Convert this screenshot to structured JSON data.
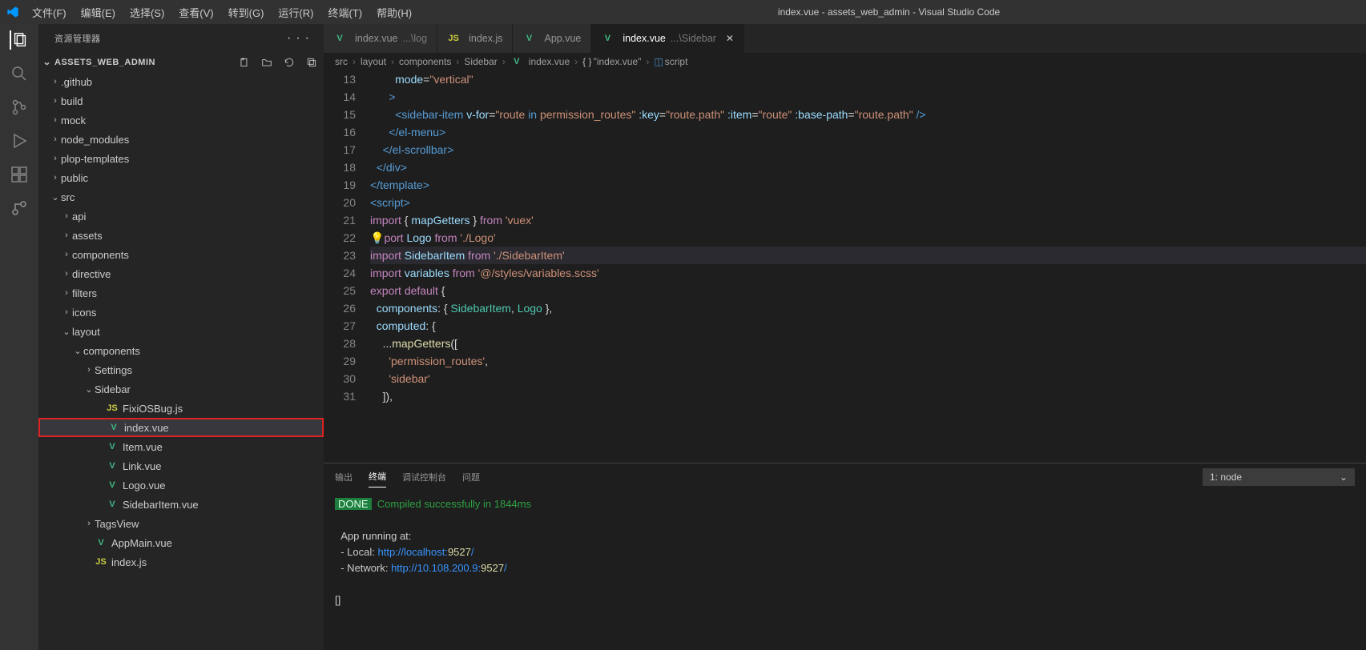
{
  "window_title": "index.vue - assets_web_admin - Visual Studio Code",
  "menu": [
    "文件(F)",
    "编辑(E)",
    "选择(S)",
    "查看(V)",
    "转到(G)",
    "运行(R)",
    "终端(T)",
    "帮助(H)"
  ],
  "sidebar_title": "资源管理器",
  "project_name": "ASSETS_WEB_ADMIN",
  "tree": [
    {
      "depth": 0,
      "tw": "›",
      "label": ".github",
      "icon": ""
    },
    {
      "depth": 0,
      "tw": "›",
      "label": "build",
      "icon": ""
    },
    {
      "depth": 0,
      "tw": "›",
      "label": "mock",
      "icon": ""
    },
    {
      "depth": 0,
      "tw": "›",
      "label": "node_modules",
      "icon": ""
    },
    {
      "depth": 0,
      "tw": "›",
      "label": "plop-templates",
      "icon": ""
    },
    {
      "depth": 0,
      "tw": "›",
      "label": "public",
      "icon": ""
    },
    {
      "depth": 0,
      "tw": "⌄",
      "label": "src",
      "icon": ""
    },
    {
      "depth": 1,
      "tw": "›",
      "label": "api",
      "icon": ""
    },
    {
      "depth": 1,
      "tw": "›",
      "label": "assets",
      "icon": ""
    },
    {
      "depth": 1,
      "tw": "›",
      "label": "components",
      "icon": ""
    },
    {
      "depth": 1,
      "tw": "›",
      "label": "directive",
      "icon": ""
    },
    {
      "depth": 1,
      "tw": "›",
      "label": "filters",
      "icon": ""
    },
    {
      "depth": 1,
      "tw": "›",
      "label": "icons",
      "icon": ""
    },
    {
      "depth": 1,
      "tw": "⌄",
      "label": "layout",
      "icon": ""
    },
    {
      "depth": 2,
      "tw": "⌄",
      "label": "components",
      "icon": ""
    },
    {
      "depth": 3,
      "tw": "›",
      "label": "Settings",
      "icon": ""
    },
    {
      "depth": 3,
      "tw": "⌄",
      "label": "Sidebar",
      "icon": ""
    },
    {
      "depth": 4,
      "tw": "",
      "label": "FixiOSBug.js",
      "icon": "js"
    },
    {
      "depth": 4,
      "tw": "",
      "label": "index.vue",
      "icon": "vue",
      "sel": true,
      "box": true
    },
    {
      "depth": 4,
      "tw": "",
      "label": "Item.vue",
      "icon": "vue"
    },
    {
      "depth": 4,
      "tw": "",
      "label": "Link.vue",
      "icon": "vue"
    },
    {
      "depth": 4,
      "tw": "",
      "label": "Logo.vue",
      "icon": "vue"
    },
    {
      "depth": 4,
      "tw": "",
      "label": "SidebarItem.vue",
      "icon": "vue"
    },
    {
      "depth": 3,
      "tw": "›",
      "label": "TagsView",
      "icon": ""
    },
    {
      "depth": 3,
      "tw": "",
      "label": "AppMain.vue",
      "icon": "vue"
    },
    {
      "depth": 3,
      "tw": "",
      "label": "index.js",
      "icon": "js"
    }
  ],
  "tabs": [
    {
      "icon": "vue",
      "label": "index.vue",
      "detail": "...\\log",
      "active": false
    },
    {
      "icon": "js",
      "label": "index.js",
      "detail": "",
      "active": false
    },
    {
      "icon": "vue",
      "label": "App.vue",
      "detail": "",
      "active": false
    },
    {
      "icon": "vue",
      "label": "index.vue",
      "detail": "...\\Sidebar",
      "active": true,
      "close": true
    }
  ],
  "breadcrumb": [
    "src",
    "layout",
    "components",
    "Sidebar",
    "index.vue",
    "\"index.vue\"",
    "script"
  ],
  "code": {
    "start": 13,
    "lines": [
      "        <span class='tk-attr'>mode</span><span class='tk-op'>=</span><span class='tk-str'>\"vertical\"</span>",
      "      <span class='tk-tag'>&gt;</span>",
      "        <span class='tk-tag'>&lt;sidebar-item</span> <span class='tk-attr'>v-for</span><span class='tk-op'>=</span><span class='tk-str'>\"route <span class='tk-bl'>in</span> permission_routes\"</span> <span class='tk-attr'>:key</span><span class='tk-op'>=</span><span class='tk-str'>\"route.path\"</span> <span class='tk-attr'>:item</span><span class='tk-op'>=</span><span class='tk-str'>\"route\"</span> <span class='tk-attr'>:base-path</span><span class='tk-op'>=</span><span class='tk-str'>\"route.path\"</span> <span class='tk-tag'>/&gt;</span>",
      "      <span class='tk-tag'>&lt;/el-menu&gt;</span>",
      "    <span class='tk-tag'>&lt;/el-scrollbar&gt;</span>",
      "  <span class='tk-tag'>&lt;/div&gt;</span>",
      "<span class='tk-tag'>&lt;/template&gt;</span>",
      "<span class='tk-tag'>&lt;script&gt;</span>",
      "<span class='tk-kw'>import</span> <span class='tk-pn'>{</span> <span class='tk-attr'>mapGetters</span> <span class='tk-pn'>}</span> <span class='tk-kw'>from</span> <span class='tk-str'>'vuex'</span>",
      "<span class='bulb'>💡</span><span class='tk-kw'>port</span> <span class='tk-attr'>Logo</span> <span class='tk-kw'>from</span> <span class='tk-str'>'./Logo'</span>",
      "<span class='tk-kw'>import</span> <span class='tk-attr'>SidebarItem</span> <span class='tk-kw'>from</span> <span class='tk-str'>'./SidebarItem'</span>",
      "<span class='tk-kw'>import</span> <span class='tk-attr'>variables</span> <span class='tk-kw'>from</span> <span class='tk-str'>'@/styles/variables.scss'</span>",
      "<span class='tk-kw'>export</span> <span class='tk-kw'>default</span> <span class='tk-pn'>{</span>",
      "  <span class='tk-attr'>components</span><span class='tk-pn'>:</span> <span class='tk-pn'>{</span> <span class='tk-cls'>SidebarItem</span><span class='tk-pn'>,</span> <span class='tk-cls'>Logo</span> <span class='tk-pn'>},</span>",
      "  <span class='tk-attr'>computed</span><span class='tk-pn'>:</span> <span class='tk-pn'>{</span>",
      "    <span class='tk-pn'>...</span><span class='tk-fn'>mapGetters</span><span class='tk-pn'>([</span>",
      "      <span class='tk-str'>'permission_routes'</span><span class='tk-pn'>,</span>",
      "      <span class='tk-str'>'sidebar'</span>",
      "    <span class='tk-pn'>]),</span>"
    ],
    "hl_index": 10
  },
  "panel_tabs": [
    "输出",
    "终端",
    "调试控制台",
    "问题"
  ],
  "panel_active": 1,
  "panel_select": "1: node",
  "terminal": {
    "done": "DONE",
    "done_msg": "Compiled successfully in 1844ms",
    "running": "App running at:",
    "local_label": "- Local:   ",
    "local_url": "http://localhost:",
    "local_port": "9527",
    "net_label": "- Network: ",
    "net_url": "http://10.108.200.9:",
    "net_port": "9527",
    "cursor": "[]"
  }
}
